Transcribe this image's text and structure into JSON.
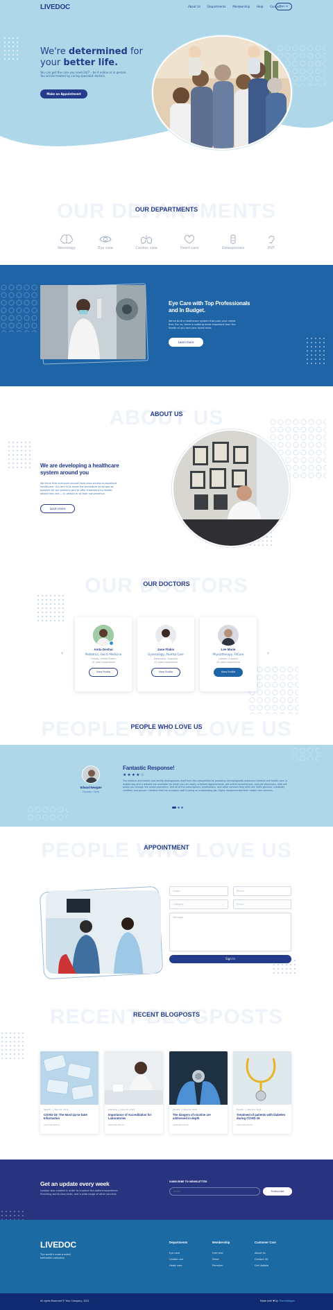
{
  "brand": "LIVEDOC",
  "nav": {
    "items": [
      "About Us",
      "Departments",
      "Membership",
      "Help",
      "Contact"
    ],
    "signin": "Sign in"
  },
  "hero": {
    "title_a": "We're ",
    "title_b": "determined",
    "title_c": " for",
    "title_d": "your ",
    "title_e": "better life.",
    "subtitle": "You can get the care you need 24/7 – be it online or in person. You will be treated by caring specialist doctors.",
    "cta": "Make an Appointment"
  },
  "departments": {
    "ghost": "OUR DEPARTMENTS",
    "title": "OUR DEPARTMENTS",
    "items": [
      "Neurology",
      "Eye care",
      "Cardiac care",
      "Heart care",
      "Osteoporosis",
      "ENT"
    ]
  },
  "eyecare": {
    "title_a": "Eye Care with Top Professionals",
    "title_b": "and In Budget.",
    "text": "We've built a healthcare system that puts your needs first. For us, there is nothing more important than the health of you and your loved ones.",
    "cta": "Learn more"
  },
  "about": {
    "ghost": "ABOUT US",
    "title": "ABOUT US",
    "heading_a": "We are developing a healthcare",
    "heading_b": "system around you",
    "text": "We think that everyone should have easy access to excellent healthcare. Our aim is to make the procedure as simple as possible for our patients and to offer treatment no matter where they are — in person or at their convenience.",
    "cta": "Learn more"
  },
  "doctors": {
    "ghost": "OUR DOCTORS",
    "title": "OUR DOCTORS",
    "view": "View Profile",
    "items": [
      {
        "name": "Anita Deshai",
        "spec": "Pediatrics, Gochi Medicine",
        "loc": "Florida, United States",
        "exp": "15 years experience"
      },
      {
        "name": "Jane Flakis",
        "spec": "Gynecology, Alomka Care",
        "loc": "Melbourne, Australia",
        "exp": "12 years experience"
      },
      {
        "name": "Lee Marie",
        "spec": "Physiotherapy, FitCare",
        "loc": "London, England",
        "exp": "20 years experience"
      }
    ]
  },
  "testimonials": {
    "ghost": "PEOPLE WHO LOVE US",
    "title": "PEOPLE WHO LOVE US",
    "name": "Edward Newgate",
    "role": "Founder Circle",
    "quote_title": "Fantastic Response!",
    "stars": "★★★★☆",
    "rating": 4,
    "quote": "The medical and health care facility distinguishes itself from the competition by providing technologically advanced medical and health care. A mobile app and a website are available via which you can easily schedule appointments, get online consultations, and see physicians, who will assist you through the whole procedure. And all of the prescriptions, medications, and other services they offer are 100% genuine, medically certified, and proven. I believe that the company staff is doing an outstanding job. Highly recommended their health care services."
  },
  "appointment": {
    "ghost": "PEOPLE WHO LOVE US",
    "title": "APPOINTMENT",
    "name": "Name",
    "phone": "Phone",
    "category": "Category",
    "email": "Email",
    "message": "Message",
    "submit": "Sign In"
  },
  "blog": {
    "ghost": "RECENT BLOGPOSTS",
    "title": "RECENT BLOGPOSTS",
    "readmore": "read full article",
    "posts": [
      {
        "cat": "Health",
        "date": "Nov 02, 2021",
        "title": "COVID-19: The Most Up-to-Date Information"
      },
      {
        "cat": "Lifestyle",
        "date": "Nov 03, 2021",
        "title": "Importance of Accreditation for Laboratories"
      },
      {
        "cat": "Health",
        "date": "Nov 02, 2021",
        "title": "The dangers of nicotine are addressed in depth"
      },
      {
        "cat": "Health",
        "date": "Dec 02, 2021",
        "title": "Treatment of patients with diabetes during COVID-19"
      }
    ]
  },
  "newsletter": {
    "title": "Get an update every week",
    "text": "Livedoc was created in order to improve the patient experience. Providing world-class tests, and a wide range of other services.",
    "label": "SUBSCRIBE TO NEWSLETTER",
    "placeholder": "Email",
    "button": "Subscribe"
  },
  "footer": {
    "brand": "LIVEDOC",
    "tagline": "The world's most trusted telehealth company.",
    "cols": [
      {
        "head": "Departments",
        "links": [
          "Eye care",
          "Cardiac are",
          "Heart care"
        ]
      },
      {
        "head": "Membership",
        "links": [
          "Free trial",
          "Silver",
          "Premium"
        ]
      },
      {
        "head": "Customer Care",
        "links": [
          "About Us",
          "Contact US",
          "Get Update"
        ]
      }
    ],
    "copyright": "All rights Reserved © Your Company, 2021",
    "made_a": "Made with ♥ by ",
    "made_b": "ThemeWagon"
  },
  "colors": {
    "navy": "#243a8a",
    "hero": "#aed8ea",
    "blue": "#1f64a6",
    "footer": "#1b6aa4"
  }
}
